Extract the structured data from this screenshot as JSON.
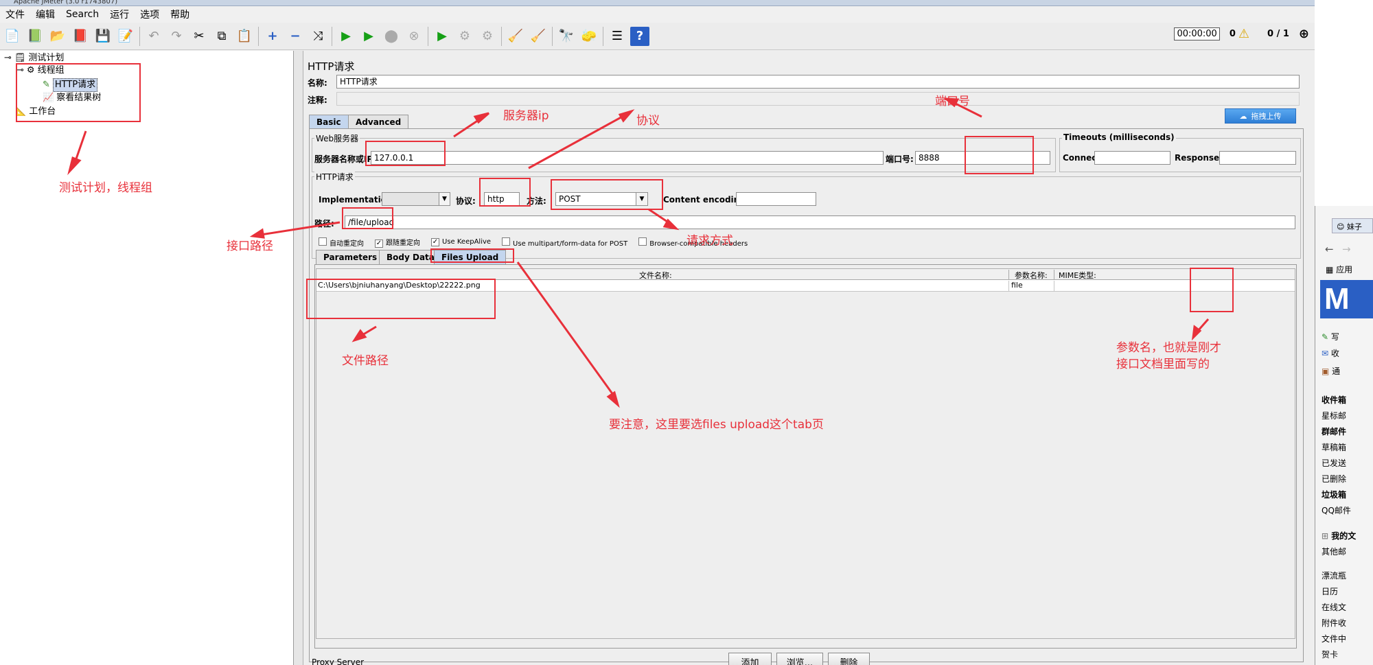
{
  "window": {
    "title": "Apache JMeter (3.0 r1743807)"
  },
  "menu": [
    "文件",
    "编辑",
    "Search",
    "运行",
    "选项",
    "帮助"
  ],
  "toolbar": {
    "timer": "00:00:00",
    "warnings": "0",
    "threads": "0 / 1"
  },
  "tree": {
    "plan": "测试计划",
    "thread_group": "线程组",
    "http": "HTTP请求",
    "result": "察看结果树",
    "workbench": "工作台"
  },
  "panel": {
    "title": "HTTP请求",
    "name_label": "名称:",
    "name_value": "HTTP请求",
    "comment_label": "注释:",
    "tabs": [
      "Basic",
      "Advanced"
    ],
    "upload_btn": "拖拽上传",
    "web_server": "Web服务器",
    "server_label": "服务器名称或IP:",
    "server_value": "127.0.0.1",
    "port_label": "端口号:",
    "port_value": "8888",
    "timeouts": "Timeouts (milliseconds)",
    "connect": "Connect:",
    "response": "Response:",
    "http_request": "HTTP请求",
    "impl_label": "Implementation:",
    "protocol_label": "协议:",
    "protocol_value": "http",
    "method_label": "方法:",
    "method_value": "POST",
    "encoding_label": "Content encoding:",
    "path_label": "路径:",
    "path_value": "/file/upload",
    "checks": [
      "自动重定向",
      "跟随重定向",
      "Use KeepAlive",
      "Use multipart/form-data for POST",
      "Browser-compatible headers"
    ],
    "subtabs": [
      "Parameters",
      "Body Data",
      "Files Upload"
    ],
    "table_headers": [
      "文件名称:",
      "参数名称:",
      "MIME类型:"
    ],
    "file_row": {
      "file": "C:\\Users\\bjniuhanyang\\Desktop\\22222.png",
      "param": "file",
      "mime": ""
    },
    "buttons": {
      "add": "添加",
      "browse": "浏览...",
      "delete": "删除"
    },
    "proxy": "Proxy Server"
  },
  "annotations": {
    "tree": "测试计划，线程组",
    "server": "服务器ip",
    "protocol": "协议",
    "port": "端口号",
    "path": "接口路径",
    "method": "请求方式",
    "file": "文件路径",
    "param": "参数名，也就是刚才",
    "param2": "接口文档里面写的",
    "tab": "要注意，这里要选files upload这个tab页"
  },
  "browser": {
    "tab": "妹子",
    "items": [
      "应用",
      "写",
      "收",
      "通",
      "收件箱",
      "星标邮",
      "群邮件",
      "草稿箱",
      "已发送",
      "已删除",
      "垃圾箱",
      "QQ邮件",
      "我的文",
      "其他邮",
      "漂流瓶",
      "日历",
      "在线文",
      "附件收",
      "文件中",
      "贺卡"
    ]
  }
}
